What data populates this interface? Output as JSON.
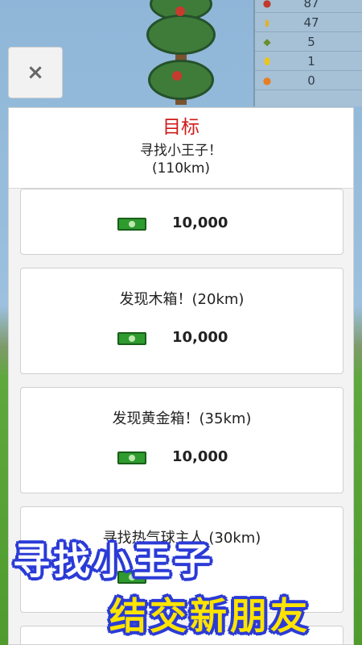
{
  "inventory": [
    {
      "icon": "apple-icon",
      "glyph": "●",
      "color": "#c0392b",
      "value": "87"
    },
    {
      "icon": "banana-icon",
      "glyph": "◗",
      "color": "#e1b12c",
      "value": "47"
    },
    {
      "icon": "leaf-icon",
      "glyph": "◆",
      "color": "#6a8f2b",
      "value": "5"
    },
    {
      "icon": "lemon-icon",
      "glyph": "⬮",
      "color": "#f1c40f",
      "value": "1"
    },
    {
      "icon": "orange-icon",
      "glyph": "●",
      "color": "#e67e22",
      "value": "0"
    }
  ],
  "close": {
    "label": "×"
  },
  "panel": {
    "title": "目标",
    "goal": "寻找小王子！",
    "goal_distance": "(110km)"
  },
  "cards": [
    {
      "title": "",
      "reward": "10,000"
    },
    {
      "title": "发现木箱！(20km)",
      "reward": "10,000"
    },
    {
      "title": "发现黄金箱！(35km)",
      "reward": "10,000"
    },
    {
      "title": "寻找热气球主人 (30km)",
      "reward": ""
    }
  ],
  "banner": {
    "line1": "寻找小王子",
    "line2": "结交新朋友"
  },
  "colors": {
    "title_red": "#d01a1a",
    "banner_blue": "#2b3bd6",
    "banner_yellow": "#ffe400",
    "cash_green": "#2e9b2e"
  }
}
